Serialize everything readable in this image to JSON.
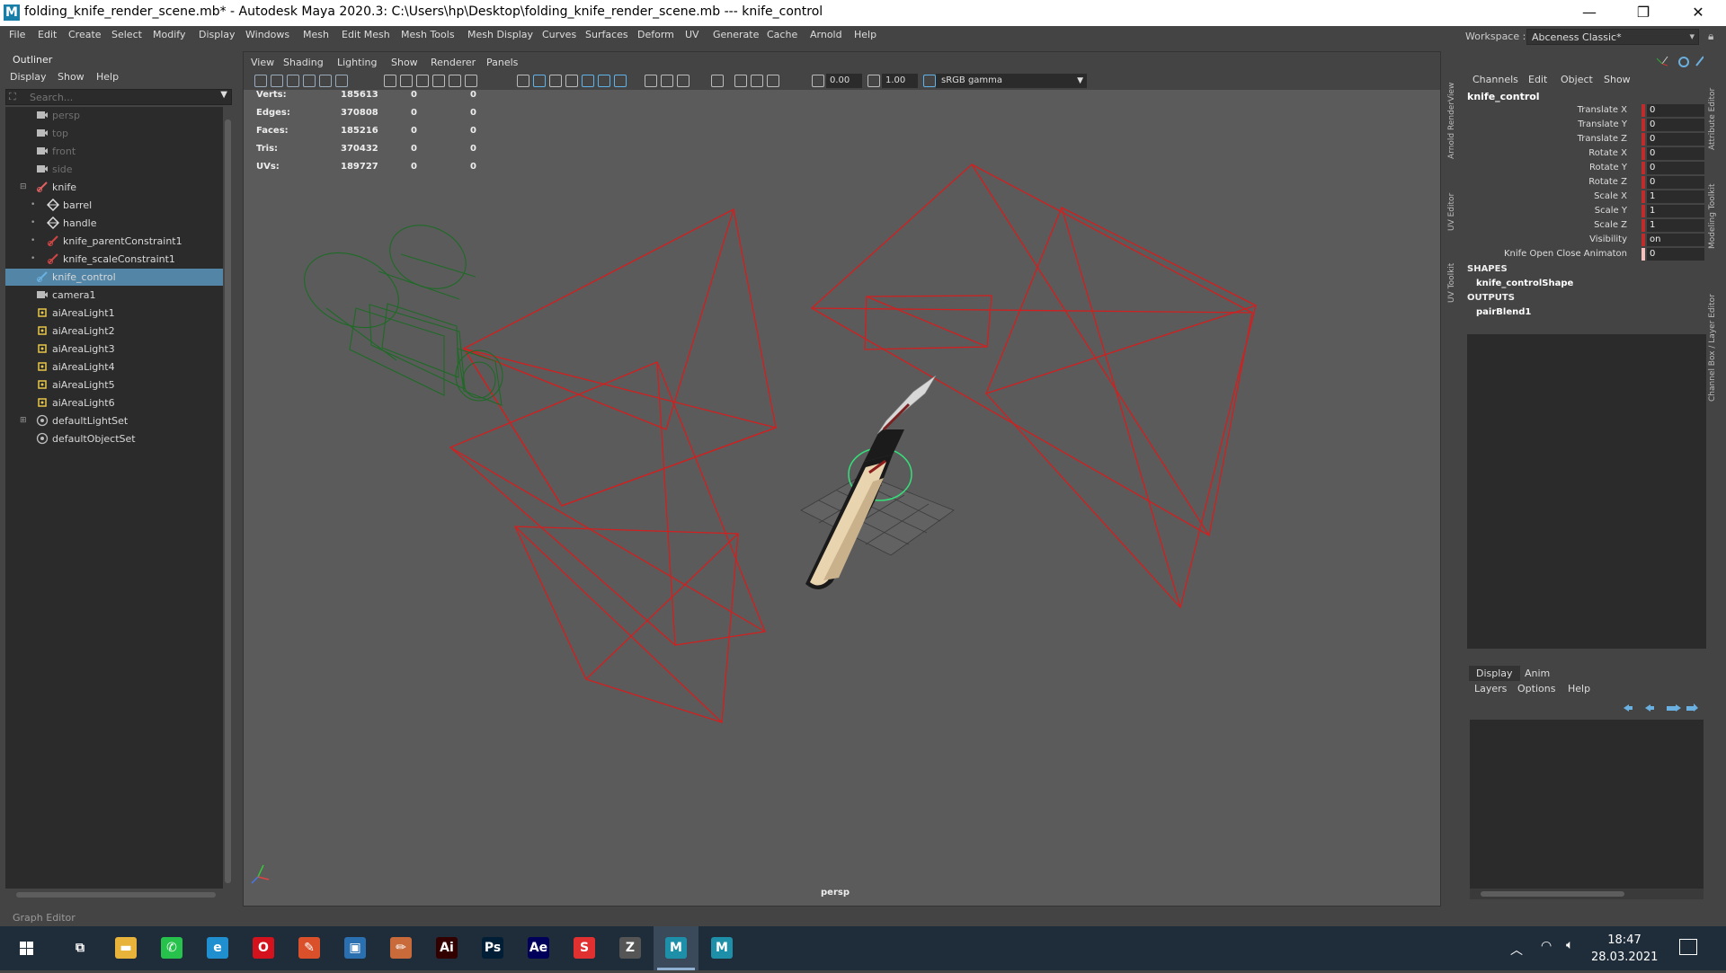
{
  "window": {
    "title": "folding_knife_render_scene.mb* - Autodesk Maya 2020.3: C:\\Users\\hp\\Desktop\\folding_knife_render_scene.mb   ---   knife_control",
    "icon_letter": "M",
    "minimize": "—",
    "maximize": "❐",
    "close": "✕"
  },
  "menubar": [
    "File",
    "Edit",
    "Create",
    "Select",
    "Modify",
    "Display",
    "Windows",
    "Mesh",
    "Edit Mesh",
    "Mesh Tools",
    "Mesh Display",
    "Curves",
    "Surfaces",
    "Deform",
    "UV",
    "Generate",
    "Cache",
    "Arnold",
    "Help"
  ],
  "workspace": {
    "label": "Workspace :",
    "value": "Abceness Classic*"
  },
  "outliner": {
    "title": "Outliner",
    "menu": [
      "Display",
      "Show",
      "Help"
    ],
    "search_placeholder": "Search...",
    "items": [
      {
        "label": "persp",
        "icon": "camera-icon",
        "indent": 1,
        "dim": true
      },
      {
        "label": "top",
        "icon": "camera-icon",
        "indent": 1,
        "dim": true
      },
      {
        "label": "front",
        "icon": "camera-icon",
        "indent": 1,
        "dim": true
      },
      {
        "label": "side",
        "icon": "camera-icon",
        "indent": 1,
        "dim": true
      },
      {
        "label": "knife",
        "icon": "transform-icon",
        "indent": 1,
        "expander": "minus"
      },
      {
        "label": "barrel",
        "icon": "mesh-icon",
        "indent": 2,
        "expander": "dot"
      },
      {
        "label": "handle",
        "icon": "mesh-icon",
        "indent": 2,
        "expander": "dot"
      },
      {
        "label": "knife_parentConstraint1",
        "icon": "constraint-icon",
        "indent": 2,
        "expander": "dot"
      },
      {
        "label": "knife_scaleConstraint1",
        "icon": "constraint-icon",
        "indent": 2,
        "expander": "dot"
      },
      {
        "label": "knife_control",
        "icon": "curve-icon",
        "indent": 1,
        "selected": true
      },
      {
        "label": "camera1",
        "icon": "camera-icon",
        "indent": 1
      },
      {
        "label": "aiAreaLight1",
        "icon": "light-icon",
        "indent": 1
      },
      {
        "label": "aiAreaLight2",
        "icon": "light-icon",
        "indent": 1
      },
      {
        "label": "aiAreaLight3",
        "icon": "light-icon",
        "indent": 1
      },
      {
        "label": "aiAreaLight4",
        "icon": "light-icon",
        "indent": 1
      },
      {
        "label": "aiAreaLight5",
        "icon": "light-icon",
        "indent": 1
      },
      {
        "label": "aiAreaLight6",
        "icon": "light-icon",
        "indent": 1
      },
      {
        "label": "defaultLightSet",
        "icon": "set-icon",
        "indent": 1,
        "expander": "plus"
      },
      {
        "label": "defaultObjectSet",
        "icon": "set-icon",
        "indent": 1
      }
    ]
  },
  "viewport": {
    "menu": [
      "View",
      "Shading",
      "Lighting",
      "Show",
      "Renderer",
      "Panels"
    ],
    "exposure": "0.00",
    "gamma_value": "1.00",
    "color_space": "sRGB gamma",
    "camera": "persp",
    "hud": [
      {
        "label": "Verts:",
        "v1": "185613",
        "v2": "0",
        "v3": "0"
      },
      {
        "label": "Edges:",
        "v1": "370808",
        "v2": "0",
        "v3": "0"
      },
      {
        "label": "Faces:",
        "v1": "185216",
        "v2": "0",
        "v3": "0"
      },
      {
        "label": "Tris:",
        "v1": "370432",
        "v2": "0",
        "v3": "0"
      },
      {
        "label": "UVs:",
        "v1": "189727",
        "v2": "0",
        "v3": "0"
      }
    ],
    "axis": {
      "x": "x",
      "y": "y",
      "z": "z"
    }
  },
  "side_tabs_left": [
    "Arnold RenderView",
    "UV Editor",
    "UV Toolkit"
  ],
  "side_tabs_right": [
    "Attribute Editor",
    "Modeling Toolkit",
    "Channel Box / Layer Editor"
  ],
  "channel_box": {
    "menu": [
      "Channels",
      "Edit",
      "Object",
      "Show"
    ],
    "object": "knife_control",
    "attributes": [
      {
        "label": "Translate X",
        "value": "0"
      },
      {
        "label": "Translate Y",
        "value": "0"
      },
      {
        "label": "Translate Z",
        "value": "0"
      },
      {
        "label": "Rotate X",
        "value": "0"
      },
      {
        "label": "Rotate Y",
        "value": "0"
      },
      {
        "label": "Rotate Z",
        "value": "0"
      },
      {
        "label": "Scale X",
        "value": "1"
      },
      {
        "label": "Scale Y",
        "value": "1"
      },
      {
        "label": "Scale Z",
        "value": "1"
      },
      {
        "label": "Visibility",
        "value": "on"
      },
      {
        "label": "Knife Open Close Animaton",
        "value": "0"
      }
    ],
    "shapes_header": "SHAPES",
    "shape": "knife_controlShape",
    "outputs_header": "OUTPUTS",
    "output": "pairBlend1"
  },
  "layer_editor": {
    "tabs": [
      "Display",
      "Anim"
    ],
    "menu": [
      "Layers",
      "Options",
      "Help"
    ]
  },
  "graph_editor_label": "Graph Editor",
  "taskbar": {
    "apps": [
      {
        "name": "task-view",
        "glyph": "⧉",
        "color": "transparent"
      },
      {
        "name": "file-explorer",
        "glyph": "▬",
        "color": "#e8b33a"
      },
      {
        "name": "whatsapp",
        "glyph": "✆",
        "color": "#27c24c"
      },
      {
        "name": "edge",
        "glyph": "e",
        "color": "#1f8fd0"
      },
      {
        "name": "opera",
        "glyph": "O",
        "color": "#d4121e"
      },
      {
        "name": "artstudio",
        "glyph": "✎",
        "color": "#d9502a"
      },
      {
        "name": "app-box",
        "glyph": "▣",
        "color": "#2a6fb0"
      },
      {
        "name": "pencil",
        "glyph": "✏",
        "color": "#c86a3a"
      },
      {
        "name": "illustrator",
        "glyph": "Ai",
        "color": "#330000"
      },
      {
        "name": "photoshop",
        "glyph": "Ps",
        "color": "#001e36"
      },
      {
        "name": "after-effects",
        "glyph": "Ae",
        "color": "#00005b"
      },
      {
        "name": "substance",
        "glyph": "S",
        "color": "#e03030"
      },
      {
        "name": "zbrush",
        "glyph": "Z",
        "color": "#555555"
      },
      {
        "name": "maya",
        "glyph": "M",
        "color": "#1e8fa8"
      },
      {
        "name": "maya-2",
        "glyph": "M",
        "color": "#1e8fa8"
      }
    ],
    "time": "18:47",
    "date": "28.03.2021"
  }
}
